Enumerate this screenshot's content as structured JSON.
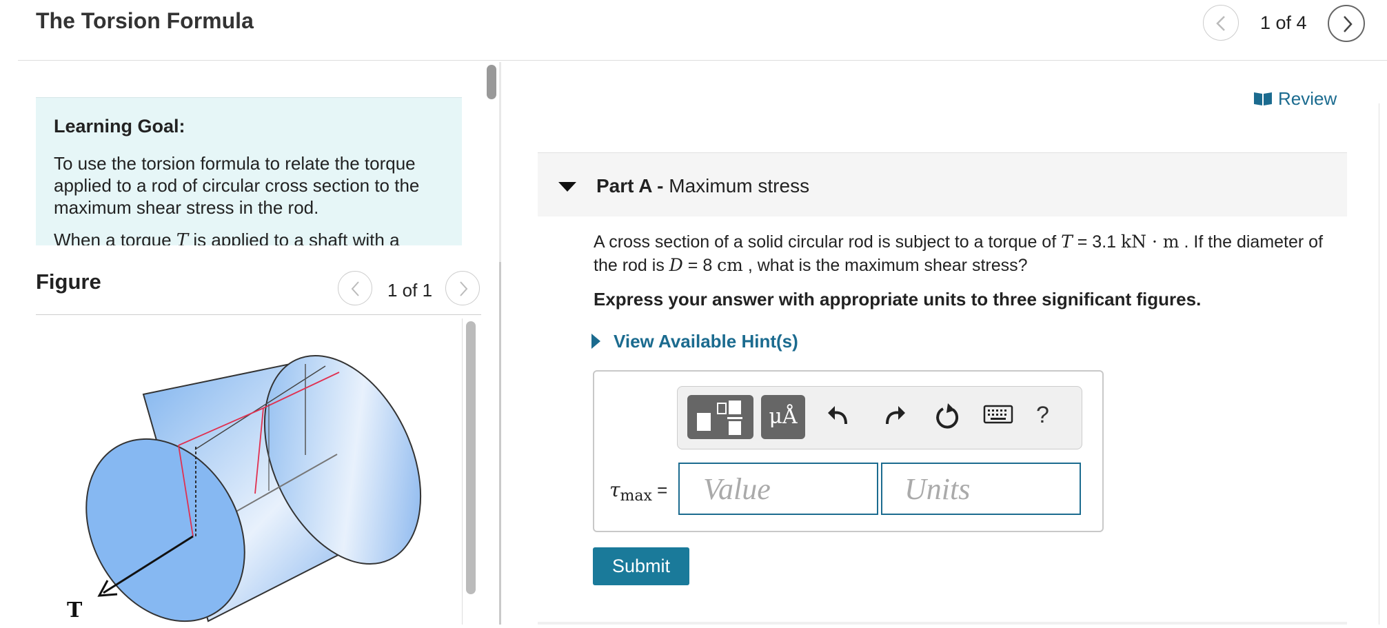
{
  "header": {
    "title": "The Torsion Formula",
    "pager": "1 of 4"
  },
  "learning_goal": {
    "title": "Learning Goal:",
    "text": "To use the torsion formula to relate the torque applied to a rod of circular cross section to the maximum shear stress in the rod.",
    "cut_text_pre": "When a torque ",
    "cut_text_var": "T",
    "cut_text_post": " is applied to a shaft with a"
  },
  "figure": {
    "title": "Figure",
    "pager": "1 of 1",
    "torque_label": "T"
  },
  "review": {
    "label": "Review"
  },
  "part_a": {
    "label": "Part A -",
    "title": "Maximum stress",
    "question_pre": "A cross section of a solid circular rod is subject to a torque of ",
    "T_var": "T",
    "T_val": " = 3.1 ",
    "T_unit": "kN · m",
    "question_mid": " . If the diameter of the rod is ",
    "D_var": "D",
    "D_val": " = 8 ",
    "D_unit": "cm",
    "question_post": " , what is the maximum shear stress?",
    "instruction": "Express your answer with appropriate units to three significant figures.",
    "hint": "View Available Hint(s)",
    "answer_var": "τ",
    "answer_sub": "max",
    "answer_eq": " =",
    "value_placeholder": "Value",
    "units_placeholder": "Units",
    "units_button": "μÅ",
    "help": "?",
    "submit": "Submit"
  },
  "colors": {
    "accent": "#1b6b8f",
    "submit": "#1a7a9a",
    "goal_bg": "#e6f6f7"
  }
}
